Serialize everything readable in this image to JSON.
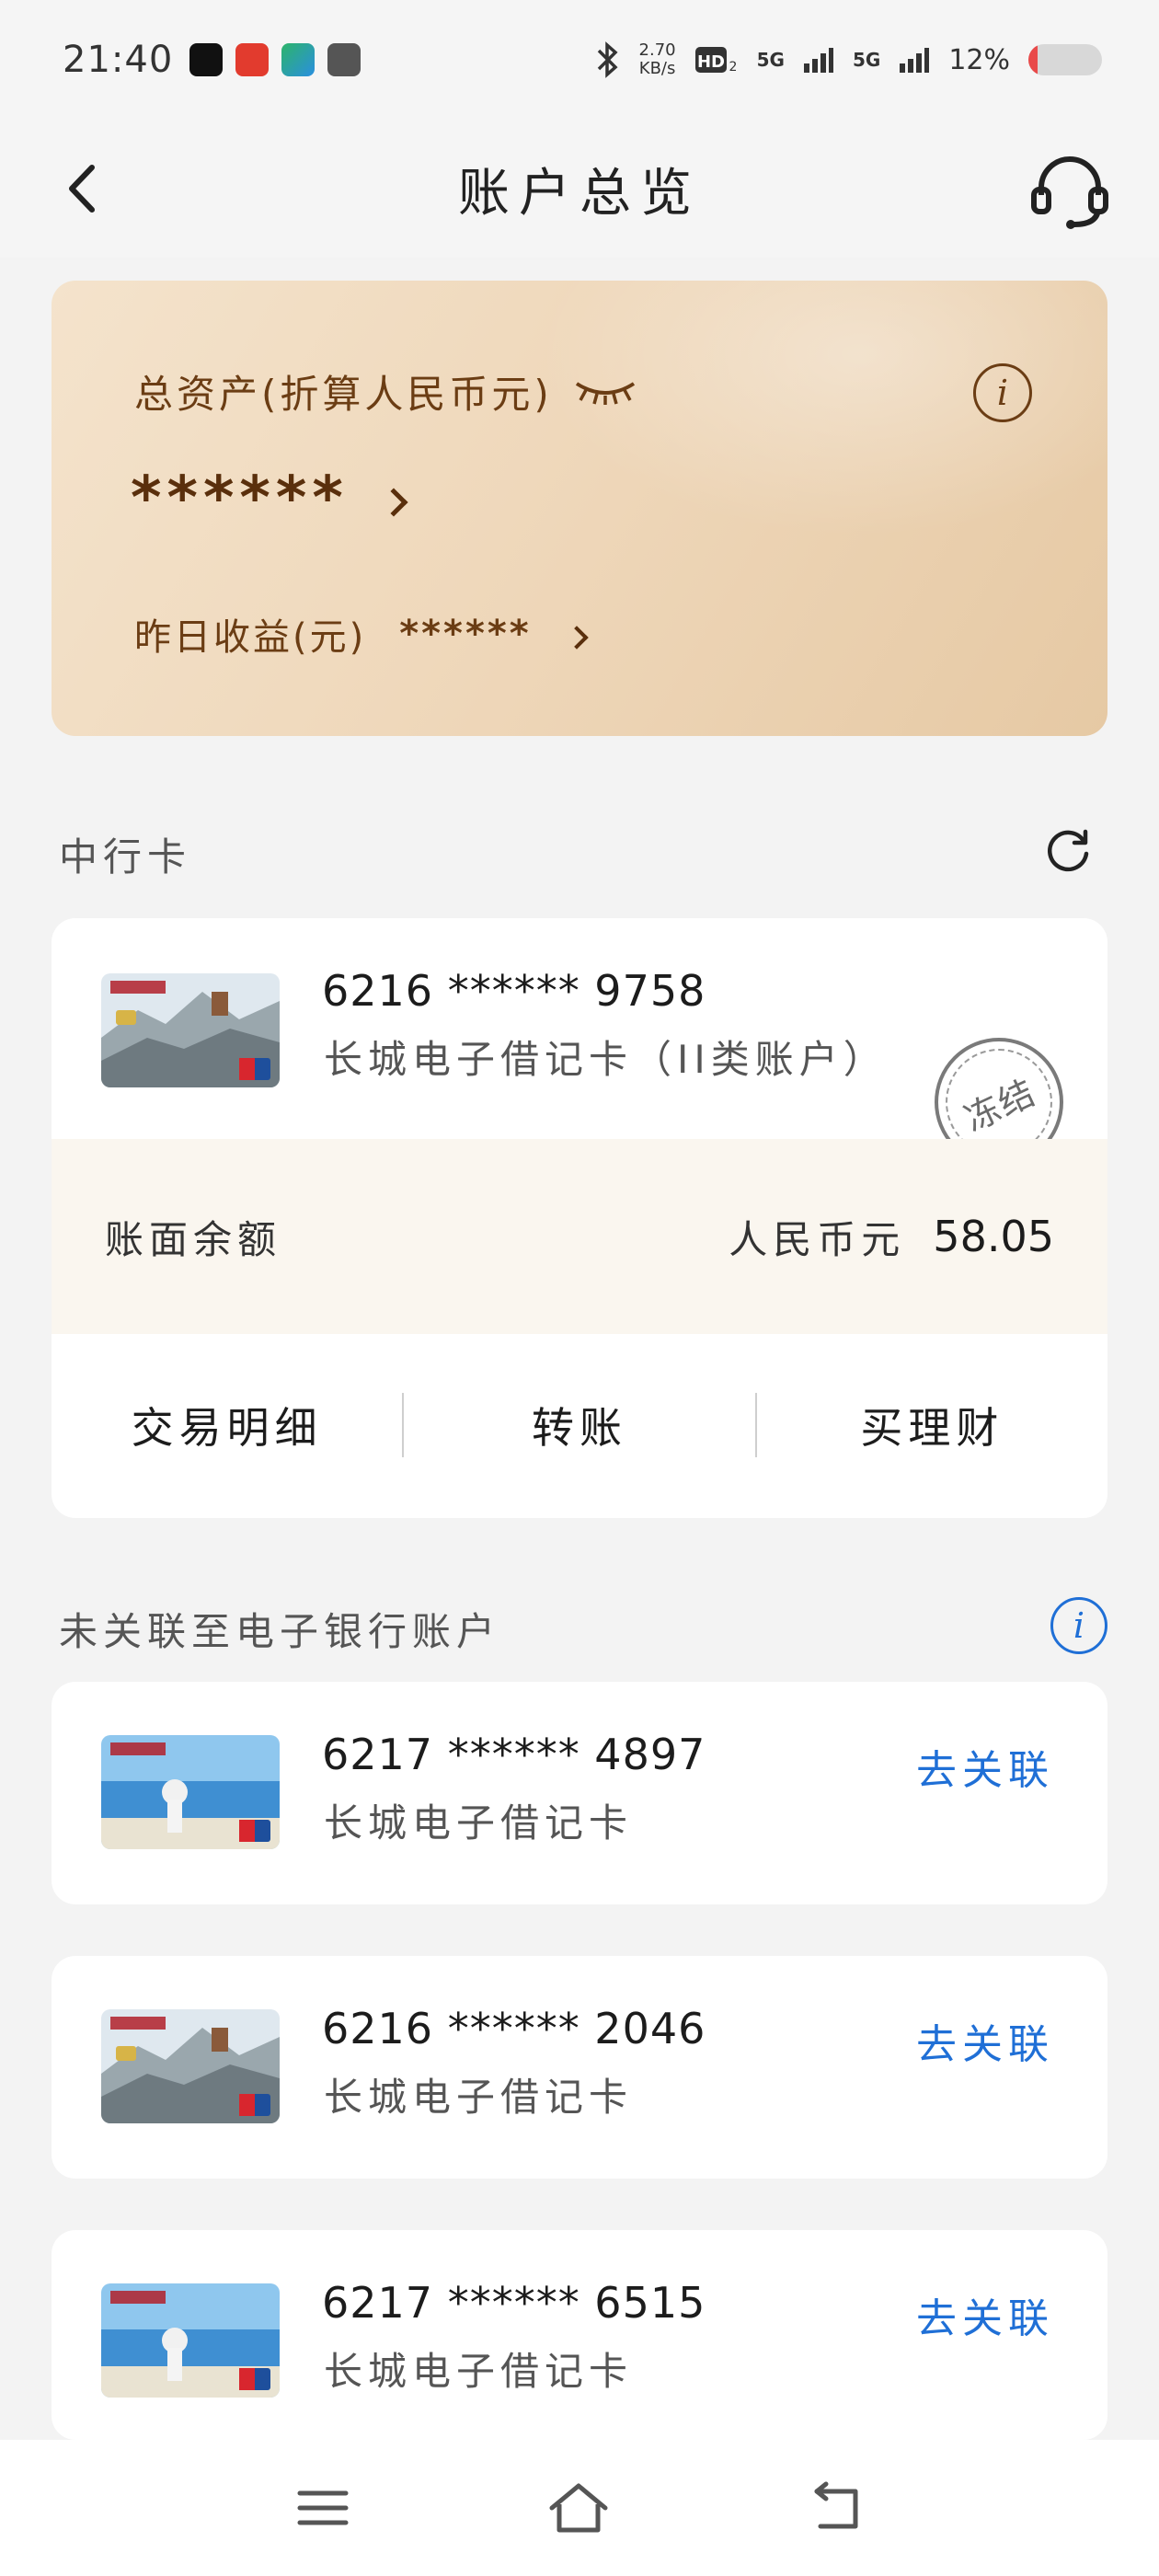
{
  "status_bar": {
    "time": "21:40",
    "net_speed_value": "2.70",
    "net_speed_unit": "KB/s",
    "signal_1": "5G",
    "signal_2": "5G",
    "battery_level": "12%",
    "battery_fraction": 0.12
  },
  "header": {
    "title": "账户总览"
  },
  "asset_card": {
    "title": "总资产(折算人民币元)",
    "total": "******",
    "yesterday_label": "昨日收益(元)",
    "yesterday_value": "******",
    "info_icon_glyph": "i"
  },
  "boc_section": {
    "title": "中行卡",
    "card": {
      "number": "6216 ****** 9758",
      "type": "长城电子借记卡（II类账户）",
      "stamp": "冻结",
      "balance_label": "账面余额",
      "currency": "人民币元",
      "amount": "58.05",
      "actions": [
        "交易明细",
        "转账",
        "买理财"
      ]
    }
  },
  "unlinked_section": {
    "title": "未关联至电子银行账户",
    "info_icon_glyph": "i",
    "cards": [
      {
        "number": "6217 ****** 4897",
        "type": "长城电子借记卡",
        "link_label": "去关联",
        "image": "beach"
      },
      {
        "number": "6216 ****** 2046",
        "type": "长城电子借记卡",
        "link_label": "去关联",
        "image": "greatwall"
      },
      {
        "number": "6217 ****** 6515",
        "type": "长城电子借记卡",
        "link_label": "去关联",
        "image": "beach"
      }
    ]
  },
  "colors": {
    "accent_blue": "#1f6fd6",
    "asset_brown": "#6b3d14",
    "background": "#f3f3f3"
  }
}
